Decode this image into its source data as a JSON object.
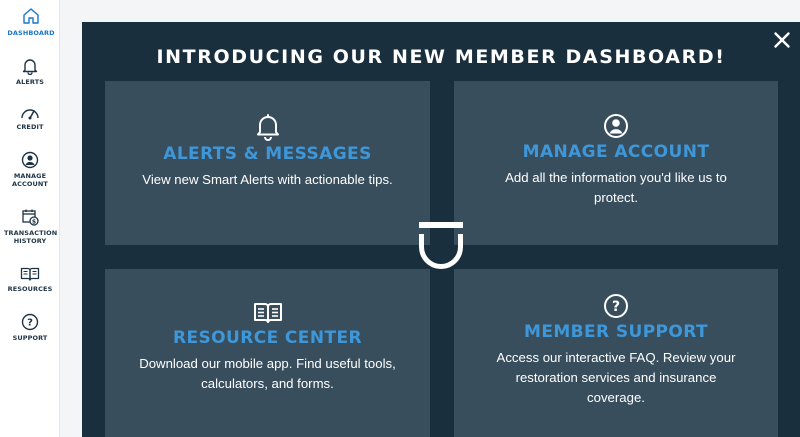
{
  "sidebar": {
    "items": [
      {
        "label": "DASHBOARD",
        "icon": "home-icon",
        "active": true
      },
      {
        "label": "ALERTS",
        "icon": "bell-icon",
        "active": false
      },
      {
        "label": "CREDIT",
        "icon": "gauge-icon",
        "active": false
      },
      {
        "label": "MANAGE ACCOUNT",
        "icon": "user-circle-icon",
        "active": false
      },
      {
        "label": "TRANSACTION HISTORY",
        "icon": "calendar-dollar-icon",
        "active": false
      },
      {
        "label": "RESOURCES",
        "icon": "book-icon",
        "active": false
      },
      {
        "label": "SUPPORT",
        "icon": "question-icon",
        "active": false
      }
    ]
  },
  "modal": {
    "title": "INTRODUCING OUR NEW MEMBER DASHBOARD!",
    "close_icon": "close-icon",
    "cards": [
      {
        "title": "ALERTS & MESSAGES",
        "description": "View new Smart Alerts with actionable tips.",
        "icon": "bell-icon"
      },
      {
        "title": "MANAGE ACCOUNT",
        "description": "Add all the information you'd like us to protect.",
        "icon": "user-circle-icon"
      },
      {
        "title": "RESOURCE CENTER",
        "description": "Download our mobile app. Find useful tools, calculators, and forms.",
        "icon": "book-icon"
      },
      {
        "title": "MEMBER SUPPORT",
        "description": "Access our interactive FAQ. Review your restoration services and insurance coverage.",
        "icon": "question-icon"
      }
    ]
  },
  "colors": {
    "modal_bg": "#1a2f3e",
    "card_bg": "#394e5d",
    "accent": "#3d97d9",
    "active_nav": "#1a76c9",
    "nav_text": "#1e3445"
  }
}
